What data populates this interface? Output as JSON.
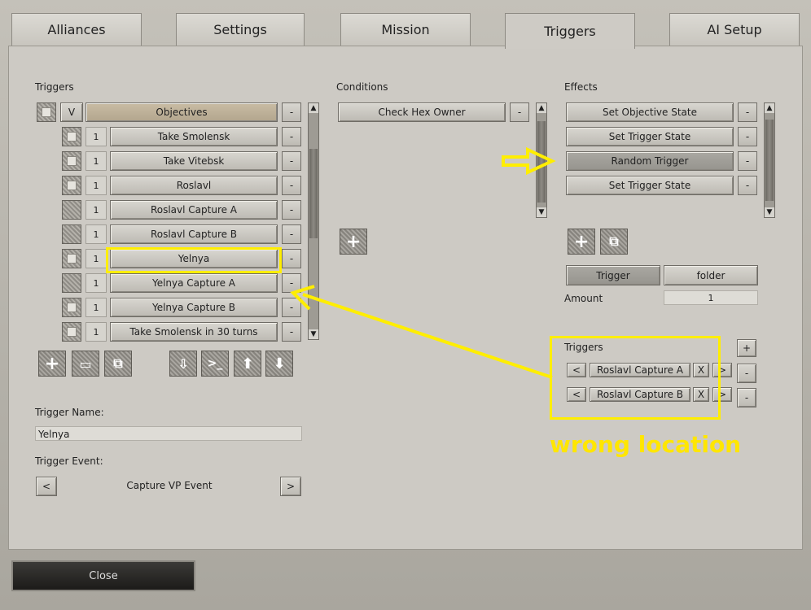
{
  "tabs": [
    "Alliances",
    "Settings",
    "Mission",
    "Triggers",
    "AI Setup"
  ],
  "triggers": {
    "heading": "Triggers",
    "header": {
      "v": "V",
      "label": "Objectives"
    },
    "rows": [
      {
        "num": "1",
        "label": "Take Smolensk"
      },
      {
        "num": "1",
        "label": "Take Vitebsk"
      },
      {
        "num": "1",
        "label": "Roslavl"
      },
      {
        "num": "1",
        "label": "Roslavl Capture A"
      },
      {
        "num": "1",
        "label": "Roslavl Capture B"
      },
      {
        "num": "1",
        "label": "Yelnya"
      },
      {
        "num": "1",
        "label": "Yelnya Capture A"
      },
      {
        "num": "1",
        "label": "Yelnya Capture B"
      },
      {
        "num": "1",
        "label": "Take Smolensk in 30 turns"
      }
    ],
    "minus": "-"
  },
  "conditions": {
    "heading": "Conditions",
    "items": [
      "Check Hex Owner"
    ]
  },
  "effects": {
    "heading": "Effects",
    "items": [
      "Set Objective State",
      "Set Trigger State",
      "Random Trigger",
      "Set Trigger State"
    ]
  },
  "effect_detail": {
    "trigger_label": "Trigger",
    "folder_label": "folder",
    "amount_label": "Amount",
    "amount_value": "1",
    "triggers_heading": "Triggers",
    "plus": "+",
    "minus": "-",
    "trigger_refs": [
      {
        "prev": "<",
        "name": "Roslavl Capture A",
        "x": "X",
        "next": ">"
      },
      {
        "prev": "<",
        "name": "Roslavl Capture B",
        "x": "X",
        "next": ">"
      }
    ]
  },
  "trigger_name": {
    "label": "Trigger Name:",
    "value": "Yelnya"
  },
  "trigger_event": {
    "label": "Trigger Event:",
    "prev": "<",
    "value": "Capture VP Event",
    "next": ">"
  },
  "annotation": {
    "text": "wrong location",
    "color": "#ffee00"
  },
  "close_label": "Close"
}
